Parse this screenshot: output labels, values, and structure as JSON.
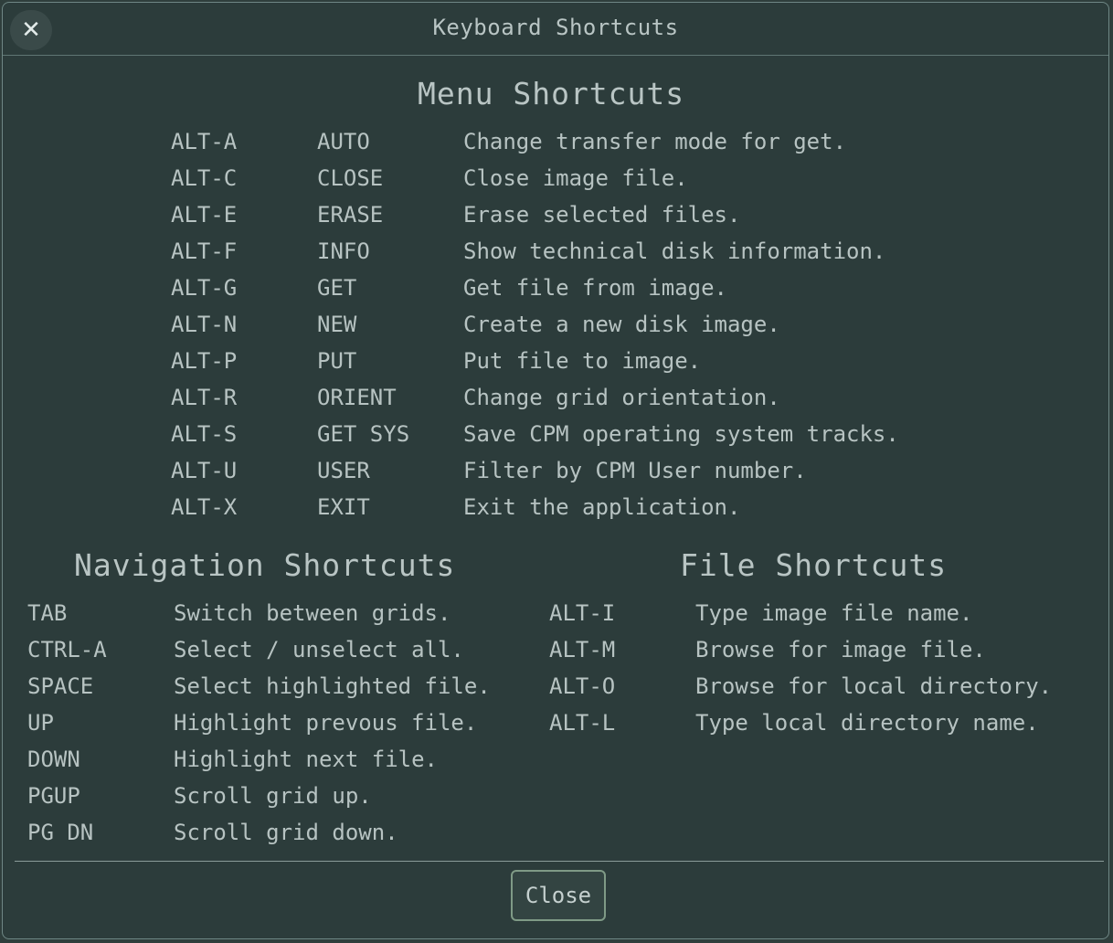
{
  "window": {
    "title": "Keyboard Shortcuts",
    "close_icon": "close-icon"
  },
  "menu": {
    "heading": "Menu Shortcuts",
    "items": [
      {
        "key": "ALT-A",
        "cmd": "AUTO",
        "desc": "Change transfer mode for get."
      },
      {
        "key": "ALT-C",
        "cmd": "CLOSE",
        "desc": "Close image file."
      },
      {
        "key": "ALT-E",
        "cmd": "ERASE",
        "desc": "Erase selected files."
      },
      {
        "key": "ALT-F",
        "cmd": "INFO",
        "desc": "Show technical disk information."
      },
      {
        "key": "ALT-G",
        "cmd": "GET",
        "desc": "Get file from image."
      },
      {
        "key": "ALT-N",
        "cmd": "NEW",
        "desc": "Create a new disk image."
      },
      {
        "key": "ALT-P",
        "cmd": "PUT",
        "desc": "Put file to image."
      },
      {
        "key": "ALT-R",
        "cmd": "ORIENT",
        "desc": "Change grid orientation."
      },
      {
        "key": "ALT-S",
        "cmd": "GET SYS",
        "desc": "Save CPM operating system tracks."
      },
      {
        "key": "ALT-U",
        "cmd": "USER",
        "desc": "Filter by CPM User number."
      },
      {
        "key": "ALT-X",
        "cmd": "EXIT",
        "desc": "Exit the application."
      }
    ]
  },
  "navigation": {
    "heading": "Navigation Shortcuts",
    "items": [
      {
        "key": "TAB",
        "desc": "Switch between grids."
      },
      {
        "key": "CTRL-A",
        "desc": "Select / unselect all."
      },
      {
        "key": "SPACE",
        "desc": "Select highlighted file."
      },
      {
        "key": "UP",
        "desc": "Highlight prevous file."
      },
      {
        "key": "DOWN",
        "desc": "Highlight next file."
      },
      {
        "key": "PGUP",
        "desc": "Scroll grid up."
      },
      {
        "key": "PG DN",
        "desc": "Scroll grid down."
      }
    ]
  },
  "file": {
    "heading": "File Shortcuts",
    "items": [
      {
        "key": "ALT-I",
        "desc": "Type image file name."
      },
      {
        "key": "ALT-M",
        "desc": "Browse for image file."
      },
      {
        "key": "ALT-O",
        "desc": "Browse for local directory."
      },
      {
        "key": "ALT-L",
        "desc": "Type local directory name."
      }
    ]
  },
  "footer": {
    "close_label": "Close"
  }
}
